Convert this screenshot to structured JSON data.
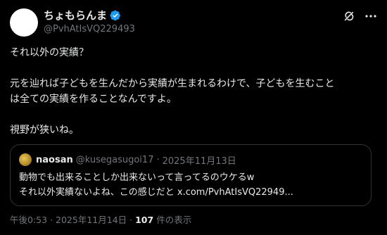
{
  "author": {
    "display_name": "ちょもらんま",
    "handle": "@PvhAtIsVQ229493",
    "verified": true,
    "avatar_icon": "avatar"
  },
  "post": {
    "lines": [
      "それ以外の実績？",
      "",
      "元を辿れば子どもを生んだから実績が生まれるわけで、子どもを生むこと",
      "は全ての実績を作ることなんですよ。",
      "",
      "視野が狭いね。"
    ]
  },
  "quote": {
    "display_name": "naosan",
    "handle": "@kusegasugoi17",
    "separator": "·",
    "date": "2025年11月13日",
    "lines": [
      "動物でも出来ることしか出来ないって言ってるのウケるw",
      "それ以外実績ないよね、この感じだと x.com/PvhAtIsVQ22949..."
    ]
  },
  "footer": {
    "time": "午後0:53",
    "separator": "·",
    "date": "2025年11月14日",
    "separator2": "·",
    "views_count": "107",
    "views_label": "件の表示"
  },
  "colors": {
    "background": "#000000",
    "text": "#e7e9ea",
    "muted": "#71767b",
    "border": "#2f3336",
    "verified": "#1d9bf0"
  },
  "icons": [
    "grok-icon",
    "more-icon",
    "verified-badge-icon"
  ]
}
